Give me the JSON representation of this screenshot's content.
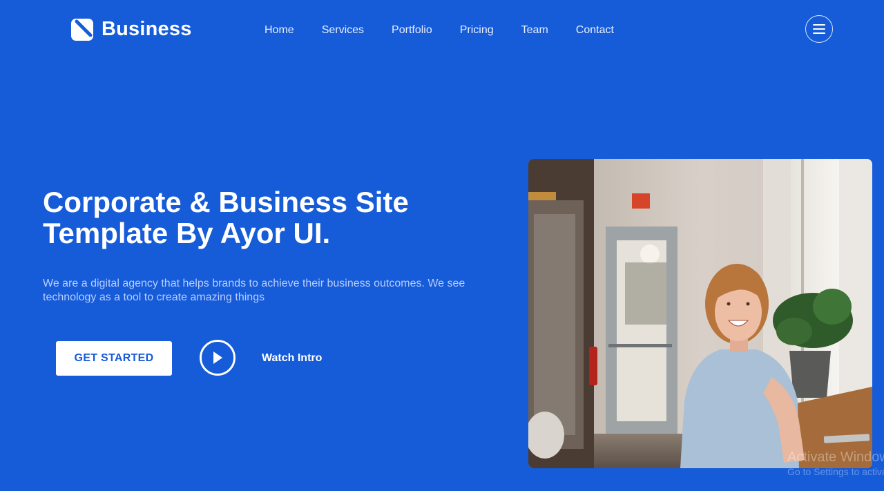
{
  "brand": {
    "name": "Business"
  },
  "nav": {
    "items": [
      "Home",
      "Services",
      "Portfolio",
      "Pricing",
      "Team",
      "Contact"
    ]
  },
  "hero": {
    "title_line1": "Corporate & Business Site",
    "title_line2": "Template By Ayor UI.",
    "description": "We are a digital agency that helps brands to achieve their business outcomes. We see technology as a tool to create amazing things",
    "cta_label": "GET STARTED",
    "watch_label": "Watch Intro"
  },
  "watermark": {
    "title": "Activate Windows",
    "subtitle": "Go to Settings to activate Windows."
  },
  "icons": {
    "logo": "logo-mark-icon",
    "menu": "hamburger-icon",
    "play": "play-icon"
  },
  "colors": {
    "background": "#165bd8",
    "button_text": "#165bd8",
    "description_text": "#b8ceff"
  }
}
